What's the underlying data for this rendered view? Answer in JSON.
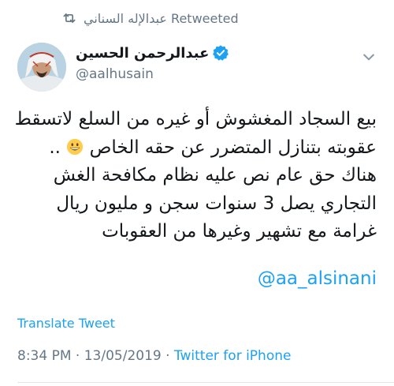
{
  "retweet": {
    "icon": "retweet-icon",
    "text": "عبدالإله السناني Retweeted"
  },
  "author": {
    "display_name": "عبدالرحمن الحسين",
    "handle": "@aalhusain",
    "verified": true,
    "verified_color": "#1da1f2"
  },
  "tweet": {
    "lines": [
      "بيع السجاد المغشوش أو غيره من السلع لاتسقط",
      "عقوبته بتنازل المتضرر عن حقه الخاص",
      "هناك حق عام نص عليه نظام مكافحة الغش",
      "التجاري يصل 3 سنوات سجن و مليون ريال",
      "غرامة مع تشهير وغيرها من العقوبات"
    ],
    "line2_suffix": " ..",
    "emoji": "grinning-face-emoji",
    "mention": "@aa_alsinani"
  },
  "actions": {
    "translate": "Translate Tweet"
  },
  "meta": {
    "time": "8:34 PM",
    "separator": " · ",
    "date": "13/05/2019",
    "client": "Twitter for iPhone"
  },
  "colors": {
    "link": "#1da1f2",
    "secondary": "#657786",
    "text": "#14171a"
  }
}
